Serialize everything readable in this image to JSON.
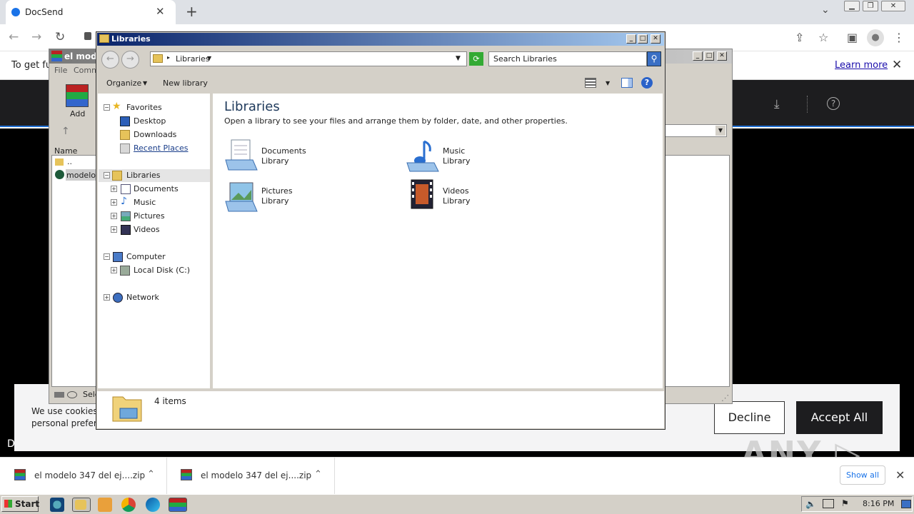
{
  "browser": {
    "tab_title": "DocSend",
    "tab_close": "✕",
    "new_tab": "+",
    "infobar_text": "To get fu",
    "learn_more": "Learn more",
    "infobar_close": "✕"
  },
  "page": {
    "cookie_line1": "We use cookies",
    "cookie_line2": "personal prefere",
    "decline": "Decline",
    "accept_all": "Accept All",
    "footer_letter": "D",
    "watermark": "ANY ▷ RUN"
  },
  "winrar": {
    "title": "el modelo",
    "menu_file": "File",
    "menu_comm": "Comm",
    "add_label": "Add",
    "col_name": "Name",
    "row_up": "..",
    "row_file": "modelo 3",
    "status": "Sele"
  },
  "explorer": {
    "title": "Libraries",
    "address": "Libraries",
    "search_placeholder": "Search Libraries",
    "organize": "Organize",
    "new_library": "New library",
    "help": "?",
    "tree": {
      "favorites": "Favorites",
      "desktop": "Desktop",
      "downloads": "Downloads",
      "recent_places": "Recent Places",
      "libraries": "Libraries",
      "documents": "Documents",
      "music": "Music",
      "pictures": "Pictures",
      "videos": "Videos",
      "computer": "Computer",
      "local_disk": "Local Disk (C:)",
      "network": "Network"
    },
    "content": {
      "heading": "Libraries",
      "description": "Open a library to see your files and arrange them by folder, date, and other properties.",
      "items": [
        {
          "name": "Documents",
          "type": "Library",
          "icon": "documents-library-icon"
        },
        {
          "name": "Music",
          "type": "Library",
          "icon": "music-library-icon"
        },
        {
          "name": "Pictures",
          "type": "Library",
          "icon": "pictures-library-icon"
        },
        {
          "name": "Videos",
          "type": "Library",
          "icon": "videos-library-icon"
        }
      ]
    },
    "status": "4 items"
  },
  "downloads": {
    "item1": "el modelo 347 del ej....zip",
    "item2": "el modelo 347 del ej....zip",
    "show_all": "Show all",
    "close": "✕"
  },
  "taskbar": {
    "start": "Start",
    "clock": "8:16 PM"
  }
}
